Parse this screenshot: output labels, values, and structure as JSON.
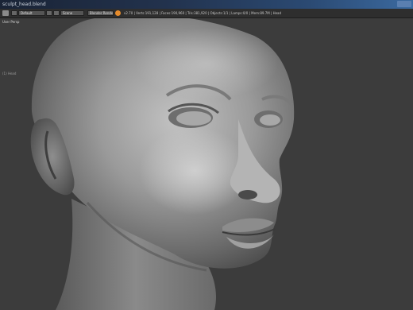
{
  "window": {
    "title": "sculpt_head.blend"
  },
  "header": {
    "editor_type": "Default",
    "scene": "Scene",
    "render_engine": "Blender Render",
    "stats": "v2.70 | Verts:191,128 | Faces:190,960 | Tris:381,920 | Objects:1/1 | Lamps:0/0 | Mem:89.7M | Head"
  },
  "viewport": {
    "label": "User Persp",
    "object_label": "(1) Head"
  },
  "colors": {
    "background": "#3c3c3c",
    "header": "#2e2e2e",
    "accent": "#e58b2c"
  }
}
